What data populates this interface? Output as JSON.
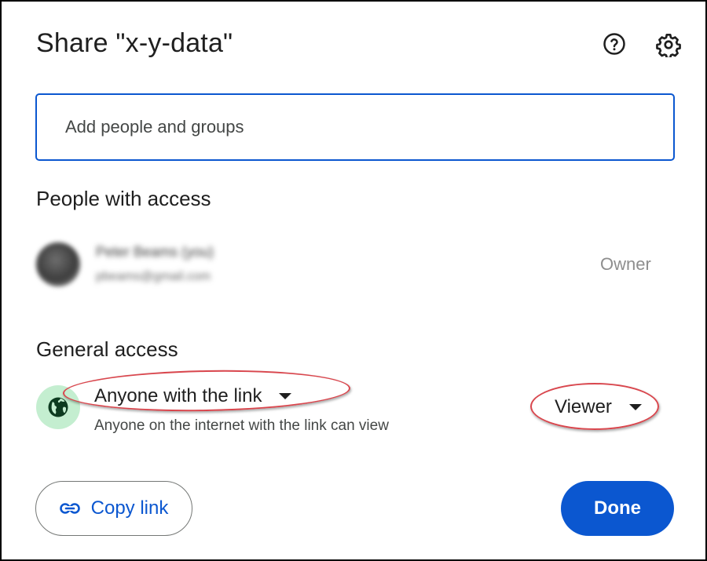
{
  "dialog": {
    "title": "Share \"x-y-data\"",
    "help_icon": "help-circle-icon",
    "settings_icon": "gear-icon"
  },
  "add_people": {
    "placeholder": "Add people and groups",
    "value": ""
  },
  "people_with_access": {
    "heading": "People with access",
    "people": [
      {
        "name": "Peter Beams (you)",
        "email": "pbeams@gmail.com",
        "role": "Owner",
        "redacted": true
      }
    ]
  },
  "general_access": {
    "heading": "General access",
    "icon": "globe-icon",
    "access_level": "Anyone with the link",
    "description": "Anyone on the internet with the link can view",
    "role": "Viewer"
  },
  "footer": {
    "copy_link_label": "Copy link",
    "copy_link_icon": "link-icon",
    "done_label": "Done"
  },
  "colors": {
    "accent": "#0b57d0",
    "globe_background": "#c4eed0",
    "annotation": "#d9464d"
  }
}
